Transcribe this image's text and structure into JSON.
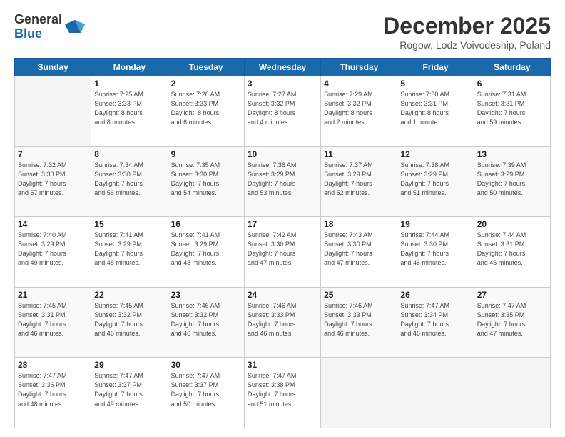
{
  "header": {
    "logo_general": "General",
    "logo_blue": "Blue",
    "month_title": "December 2025",
    "subtitle": "Rogow, Lodz Voivodeship, Poland"
  },
  "days_of_week": [
    "Sunday",
    "Monday",
    "Tuesday",
    "Wednesday",
    "Thursday",
    "Friday",
    "Saturday"
  ],
  "weeks": [
    [
      {
        "day": "",
        "info": ""
      },
      {
        "day": "1",
        "info": "Sunrise: 7:25 AM\nSunset: 3:33 PM\nDaylight: 8 hours\nand 8 minutes."
      },
      {
        "day": "2",
        "info": "Sunrise: 7:26 AM\nSunset: 3:33 PM\nDaylight: 8 hours\nand 6 minutes."
      },
      {
        "day": "3",
        "info": "Sunrise: 7:27 AM\nSunset: 3:32 PM\nDaylight: 8 hours\nand 4 minutes."
      },
      {
        "day": "4",
        "info": "Sunrise: 7:29 AM\nSunset: 3:32 PM\nDaylight: 8 hours\nand 2 minutes."
      },
      {
        "day": "5",
        "info": "Sunrise: 7:30 AM\nSunset: 3:31 PM\nDaylight: 8 hours\nand 1 minute."
      },
      {
        "day": "6",
        "info": "Sunrise: 7:31 AM\nSunset: 3:31 PM\nDaylight: 7 hours\nand 59 minutes."
      }
    ],
    [
      {
        "day": "7",
        "info": "Sunrise: 7:32 AM\nSunset: 3:30 PM\nDaylight: 7 hours\nand 57 minutes."
      },
      {
        "day": "8",
        "info": "Sunrise: 7:34 AM\nSunset: 3:30 PM\nDaylight: 7 hours\nand 56 minutes."
      },
      {
        "day": "9",
        "info": "Sunrise: 7:35 AM\nSunset: 3:30 PM\nDaylight: 7 hours\nand 54 minutes."
      },
      {
        "day": "10",
        "info": "Sunrise: 7:36 AM\nSunset: 3:29 PM\nDaylight: 7 hours\nand 53 minutes."
      },
      {
        "day": "11",
        "info": "Sunrise: 7:37 AM\nSunset: 3:29 PM\nDaylight: 7 hours\nand 52 minutes."
      },
      {
        "day": "12",
        "info": "Sunrise: 7:38 AM\nSunset: 3:29 PM\nDaylight: 7 hours\nand 51 minutes."
      },
      {
        "day": "13",
        "info": "Sunrise: 7:39 AM\nSunset: 3:29 PM\nDaylight: 7 hours\nand 50 minutes."
      }
    ],
    [
      {
        "day": "14",
        "info": "Sunrise: 7:40 AM\nSunset: 3:29 PM\nDaylight: 7 hours\nand 49 minutes."
      },
      {
        "day": "15",
        "info": "Sunrise: 7:41 AM\nSunset: 3:29 PM\nDaylight: 7 hours\nand 48 minutes."
      },
      {
        "day": "16",
        "info": "Sunrise: 7:41 AM\nSunset: 3:29 PM\nDaylight: 7 hours\nand 48 minutes."
      },
      {
        "day": "17",
        "info": "Sunrise: 7:42 AM\nSunset: 3:30 PM\nDaylight: 7 hours\nand 47 minutes."
      },
      {
        "day": "18",
        "info": "Sunrise: 7:43 AM\nSunset: 3:30 PM\nDaylight: 7 hours\nand 47 minutes."
      },
      {
        "day": "19",
        "info": "Sunrise: 7:44 AM\nSunset: 3:30 PM\nDaylight: 7 hours\nand 46 minutes."
      },
      {
        "day": "20",
        "info": "Sunrise: 7:44 AM\nSunset: 3:31 PM\nDaylight: 7 hours\nand 46 minutes."
      }
    ],
    [
      {
        "day": "21",
        "info": "Sunrise: 7:45 AM\nSunset: 3:31 PM\nDaylight: 7 hours\nand 46 minutes."
      },
      {
        "day": "22",
        "info": "Sunrise: 7:45 AM\nSunset: 3:32 PM\nDaylight: 7 hours\nand 46 minutes."
      },
      {
        "day": "23",
        "info": "Sunrise: 7:46 AM\nSunset: 3:32 PM\nDaylight: 7 hours\nand 46 minutes."
      },
      {
        "day": "24",
        "info": "Sunrise: 7:46 AM\nSunset: 3:33 PM\nDaylight: 7 hours\nand 46 minutes."
      },
      {
        "day": "25",
        "info": "Sunrise: 7:46 AM\nSunset: 3:33 PM\nDaylight: 7 hours\nand 46 minutes."
      },
      {
        "day": "26",
        "info": "Sunrise: 7:47 AM\nSunset: 3:34 PM\nDaylight: 7 hours\nand 46 minutes."
      },
      {
        "day": "27",
        "info": "Sunrise: 7:47 AM\nSunset: 3:35 PM\nDaylight: 7 hours\nand 47 minutes."
      }
    ],
    [
      {
        "day": "28",
        "info": "Sunrise: 7:47 AM\nSunset: 3:36 PM\nDaylight: 7 hours\nand 48 minutes."
      },
      {
        "day": "29",
        "info": "Sunrise: 7:47 AM\nSunset: 3:37 PM\nDaylight: 7 hours\nand 49 minutes."
      },
      {
        "day": "30",
        "info": "Sunrise: 7:47 AM\nSunset: 3:37 PM\nDaylight: 7 hours\nand 50 minutes."
      },
      {
        "day": "31",
        "info": "Sunrise: 7:47 AM\nSunset: 3:38 PM\nDaylight: 7 hours\nand 51 minutes."
      },
      {
        "day": "",
        "info": ""
      },
      {
        "day": "",
        "info": ""
      },
      {
        "day": "",
        "info": ""
      }
    ]
  ]
}
